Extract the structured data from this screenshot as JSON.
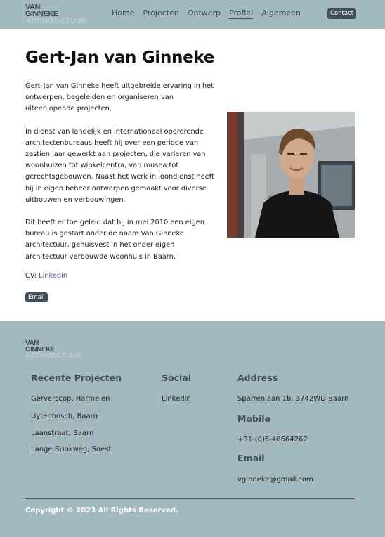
{
  "logo": {
    "line1": "VAN",
    "line2": "GINNEKE",
    "line3": "ARCHITECTUUR"
  },
  "nav": {
    "items": [
      {
        "label": "Home"
      },
      {
        "label": "Projecten"
      },
      {
        "label": "Ontwerp"
      },
      {
        "label": "Profiel"
      },
      {
        "label": "Algemeen"
      }
    ],
    "active": "Profiel",
    "contact_label": "Contact"
  },
  "main": {
    "title": "Gert-Jan van Ginneke",
    "paragraphs": [
      "Gert-Jan van Ginneke heeft uitgebreide ervaring in het ontwerpen, begeleiden en organiseren van uiteenlopende projecten.",
      "In dienst van landelijk en internationaal opererende architectenbureaus heeft hij over een periode van zestien jaar gewerkt aan projecten, die varieren van woonhuizen tot winkelcentra, van musea tot gerechtsgebouwen. Naast het werk in loondienst heeft hij in eigen beheer ontwerpen gemaakt voor diverse uitbouwen en verbouwingen.",
      "Dit heeft er toe geleid dat hij in mei 2010 een eigen bureau is gestart onder de naam Van Ginneke architectuur, gehuisvest in het onder eigen architectuur verbouwde woonhuis in Baarn."
    ],
    "cv_prefix": "CV:",
    "cv_link": "Linkedin",
    "email_button": "Email"
  },
  "footer": {
    "projects": {
      "heading": "Recente Projecten",
      "items": [
        "Gerverscop, Harmelen",
        "Uytenbosch, Baarn",
        "Laanstraat, Baarn",
        "Lange Brinkweg, Soest"
      ]
    },
    "social": {
      "heading": "Social",
      "items": [
        "Linkedin"
      ]
    },
    "address": {
      "heading": "Address",
      "value": "Sparrenlaan 1b, 3742WD Baarn"
    },
    "mobile": {
      "heading": "Mobile",
      "value": "+31-(0)6-48664262"
    },
    "email": {
      "heading": "Email",
      "value": "vginneke@gmail.com"
    },
    "copyright": "Copyright © 2023 All Rights Reserved."
  },
  "colors": {
    "header_bg": "#a3b9c0",
    "button_bg": "#414f5b",
    "link": "#5a4f8a"
  }
}
